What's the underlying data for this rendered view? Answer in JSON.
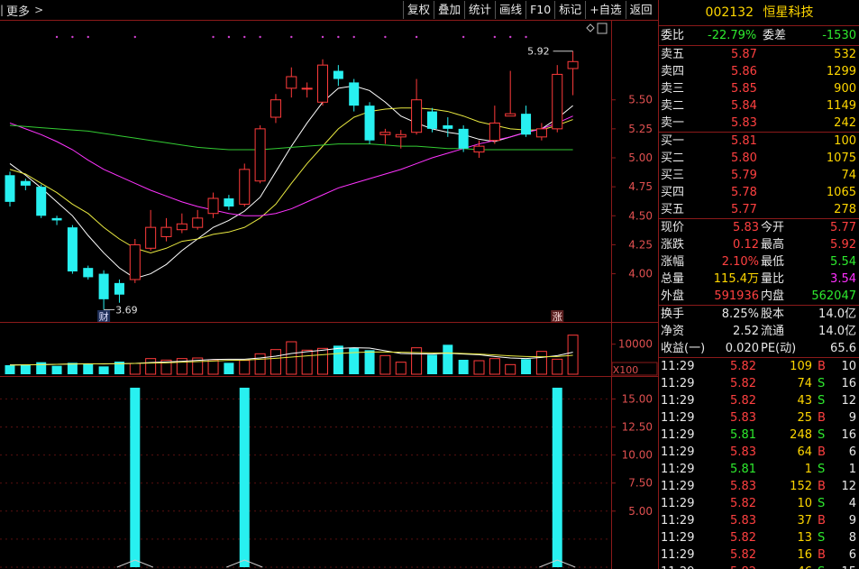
{
  "toolbar": {
    "left_label": "更多",
    "buttons": [
      "复权",
      "叠加",
      "统计",
      "画线",
      "F10",
      "标记",
      "+自选",
      "返回"
    ]
  },
  "stock": {
    "code": "002132",
    "name": "恒星科技"
  },
  "order_ratio": {
    "label1": "委比",
    "ratio": "-22.79%",
    "label2": "委差",
    "diff": "-1530"
  },
  "sell": [
    {
      "label": "卖五",
      "price": "5.87",
      "vol": "532"
    },
    {
      "label": "卖四",
      "price": "5.86",
      "vol": "1299"
    },
    {
      "label": "卖三",
      "price": "5.85",
      "vol": "900"
    },
    {
      "label": "卖二",
      "price": "5.84",
      "vol": "1149"
    },
    {
      "label": "卖一",
      "price": "5.83",
      "vol": "242"
    }
  ],
  "buy": [
    {
      "label": "买一",
      "price": "5.81",
      "vol": "100"
    },
    {
      "label": "买二",
      "price": "5.80",
      "vol": "1075"
    },
    {
      "label": "买三",
      "price": "5.79",
      "vol": "74"
    },
    {
      "label": "买四",
      "price": "5.78",
      "vol": "1065"
    },
    {
      "label": "买五",
      "price": "5.77",
      "vol": "278"
    }
  ],
  "quote": [
    {
      "l1": "现价",
      "v1": "5.83",
      "c1": "red",
      "l2": "今开",
      "v2": "5.77",
      "c2": "red"
    },
    {
      "l1": "涨跌",
      "v1": "0.12",
      "c1": "red",
      "l2": "最高",
      "v2": "5.92",
      "c2": "red"
    },
    {
      "l1": "涨幅",
      "v1": "2.10%",
      "c1": "red",
      "l2": "最低",
      "v2": "5.54",
      "c2": "green"
    },
    {
      "l1": "总量",
      "v1": "115.4万",
      "c1": "yellow",
      "l2": "量比",
      "v2": "3.54",
      "c2": "mag"
    },
    {
      "l1": "外盘",
      "v1": "591936",
      "c1": "red",
      "l2": "内盘",
      "v2": "562047",
      "c2": "green"
    }
  ],
  "fundamentals": [
    {
      "l1": "换手",
      "v1": "8.25%",
      "l2": "股本",
      "v2": "14.0亿"
    },
    {
      "l1": "净资",
      "v1": "2.52",
      "l2": "流通",
      "v2": "14.0亿"
    },
    {
      "l1": "收益(一)",
      "v1": "0.020",
      "l2": "PE(动)",
      "v2": "65.6"
    }
  ],
  "ticks": [
    {
      "t": "11:29",
      "p": "5.82",
      "v": "109",
      "d": "B",
      "n": "10"
    },
    {
      "t": "11:29",
      "p": "5.82",
      "v": "74",
      "d": "S",
      "n": "16"
    },
    {
      "t": "11:29",
      "p": "5.82",
      "v": "43",
      "d": "S",
      "n": "12"
    },
    {
      "t": "11:29",
      "p": "5.83",
      "v": "25",
      "d": "B",
      "n": "9"
    },
    {
      "t": "11:29",
      "p": "5.81",
      "v": "248",
      "d": "S",
      "n": "16"
    },
    {
      "t": "11:29",
      "p": "5.83",
      "v": "64",
      "d": "B",
      "n": "6"
    },
    {
      "t": "11:29",
      "p": "5.81",
      "v": "1",
      "d": "S",
      "n": "1"
    },
    {
      "t": "11:29",
      "p": "5.83",
      "v": "152",
      "d": "B",
      "n": "12"
    },
    {
      "t": "11:29",
      "p": "5.82",
      "v": "10",
      "d": "S",
      "n": "4"
    },
    {
      "t": "11:29",
      "p": "5.83",
      "v": "37",
      "d": "B",
      "n": "9"
    },
    {
      "t": "11:29",
      "p": "5.82",
      "v": "13",
      "d": "S",
      "n": "8"
    },
    {
      "t": "11:29",
      "p": "5.82",
      "v": "16",
      "d": "B",
      "n": "6"
    },
    {
      "t": "11:29",
      "p": "5.82",
      "v": "46",
      "d": "S",
      "n": "15"
    }
  ],
  "chart_data": [
    {
      "type": "candlestick",
      "ylim": [
        3.6,
        6.05
      ],
      "yticks": [
        "5.50",
        "5.25",
        "5.00",
        "4.75",
        "4.50",
        "4.25",
        "4.00"
      ],
      "annotations": {
        "high_label": "5.92",
        "low_label": "3.69",
        "marker_cai": "财",
        "marker_zhang": "涨"
      },
      "candles": [
        {
          "o": 4.85,
          "c": 4.62,
          "h": 4.88,
          "l": 4.58
        },
        {
          "o": 4.8,
          "c": 4.76,
          "h": 4.82,
          "l": 4.72
        },
        {
          "o": 4.75,
          "c": 4.5,
          "h": 4.77,
          "l": 4.48
        },
        {
          "o": 4.48,
          "c": 4.46,
          "h": 4.5,
          "l": 4.42
        },
        {
          "o": 4.4,
          "c": 4.02,
          "h": 4.42,
          "l": 4.0
        },
        {
          "o": 4.05,
          "c": 3.97,
          "h": 4.07,
          "l": 3.95
        },
        {
          "o": 4.0,
          "c": 3.78,
          "h": 4.03,
          "l": 3.69
        },
        {
          "o": 3.92,
          "c": 3.82,
          "h": 3.95,
          "l": 3.75
        },
        {
          "o": 3.95,
          "c": 4.25,
          "h": 4.3,
          "l": 3.92
        },
        {
          "o": 4.22,
          "c": 4.4,
          "h": 4.55,
          "l": 4.2
        },
        {
          "o": 4.32,
          "c": 4.4,
          "h": 4.48,
          "l": 4.28
        },
        {
          "o": 4.38,
          "c": 4.43,
          "h": 4.52,
          "l": 4.35
        },
        {
          "o": 4.4,
          "c": 4.48,
          "h": 4.55,
          "l": 4.38
        },
        {
          "o": 4.52,
          "c": 4.65,
          "h": 4.7,
          "l": 4.48
        },
        {
          "o": 4.65,
          "c": 4.58,
          "h": 4.68,
          "l": 4.55
        },
        {
          "o": 4.6,
          "c": 4.9,
          "h": 4.95,
          "l": 4.58
        },
        {
          "o": 4.8,
          "c": 5.25,
          "h": 5.28,
          "l": 4.78
        },
        {
          "o": 5.35,
          "c": 5.5,
          "h": 5.55,
          "l": 5.3
        },
        {
          "o": 5.6,
          "c": 5.7,
          "h": 5.78,
          "l": 5.52
        },
        {
          "o": 5.6,
          "c": 5.6,
          "h": 5.65,
          "l": 5.52
        },
        {
          "o": 5.48,
          "c": 5.8,
          "h": 5.85,
          "l": 5.45
        },
        {
          "o": 5.75,
          "c": 5.68,
          "h": 5.8,
          "l": 5.62
        },
        {
          "o": 5.65,
          "c": 5.45,
          "h": 5.68,
          "l": 5.4
        },
        {
          "o": 5.45,
          "c": 5.15,
          "h": 5.48,
          "l": 5.12
        },
        {
          "o": 5.2,
          "c": 5.22,
          "h": 5.25,
          "l": 5.12
        },
        {
          "o": 5.18,
          "c": 5.2,
          "h": 5.24,
          "l": 5.08
        },
        {
          "o": 5.22,
          "c": 5.5,
          "h": 5.68,
          "l": 5.2
        },
        {
          "o": 5.4,
          "c": 5.25,
          "h": 5.43,
          "l": 5.22
        },
        {
          "o": 5.28,
          "c": 5.25,
          "h": 5.35,
          "l": 5.18
        },
        {
          "o": 5.25,
          "c": 5.08,
          "h": 5.28,
          "l": 5.05
        },
        {
          "o": 5.05,
          "c": 5.1,
          "h": 5.15,
          "l": 5.0
        },
        {
          "o": 5.15,
          "c": 5.3,
          "h": 5.45,
          "l": 5.12
        },
        {
          "o": 5.36,
          "c": 5.38,
          "h": 5.75,
          "l": 5.36
        },
        {
          "o": 5.38,
          "c": 5.2,
          "h": 5.45,
          "l": 5.18
        },
        {
          "o": 5.18,
          "c": 5.25,
          "h": 5.3,
          "l": 5.15
        },
        {
          "o": 5.25,
          "c": 5.72,
          "h": 5.8,
          "l": 5.22
        },
        {
          "o": 5.77,
          "c": 5.83,
          "h": 5.92,
          "l": 5.54
        }
      ],
      "ma": [
        {
          "color": "#ffffff",
          "values": [
            4.95,
            4.85,
            4.74,
            4.62,
            4.5,
            4.33,
            4.18,
            4.05,
            3.96,
            4.0,
            4.08,
            4.2,
            4.3,
            4.4,
            4.46,
            4.54,
            4.66,
            4.88,
            5.1,
            5.3,
            5.48,
            5.6,
            5.62,
            5.58,
            5.48,
            5.36,
            5.3,
            5.25,
            5.22,
            5.2,
            5.16,
            5.14,
            5.18,
            5.22,
            5.25,
            5.34,
            5.45
          ]
        },
        {
          "color": "#e8e840",
          "values": [
            4.9,
            4.86,
            4.78,
            4.7,
            4.6,
            4.52,
            4.4,
            4.3,
            4.22,
            4.18,
            4.22,
            4.28,
            4.3,
            4.34,
            4.36,
            4.4,
            4.48,
            4.6,
            4.78,
            4.95,
            5.1,
            5.25,
            5.35,
            5.4,
            5.42,
            5.43,
            5.43,
            5.42,
            5.4,
            5.36,
            5.31,
            5.28,
            5.25,
            5.24,
            5.24,
            5.28,
            5.33
          ]
        },
        {
          "color": "#ff33ff",
          "values": [
            5.3,
            5.25,
            5.2,
            5.14,
            5.07,
            4.98,
            4.9,
            4.84,
            4.78,
            4.72,
            4.67,
            4.62,
            4.58,
            4.55,
            4.52,
            4.5,
            4.5,
            4.52,
            4.56,
            4.62,
            4.68,
            4.74,
            4.78,
            4.82,
            4.86,
            4.9,
            4.95,
            5.0,
            5.04,
            5.08,
            5.12,
            5.15,
            5.18,
            5.22,
            5.25,
            5.3,
            5.36
          ]
        },
        {
          "color": "#33cc33",
          "values": [
            5.28,
            5.27,
            5.26,
            5.25,
            5.24,
            5.23,
            5.21,
            5.19,
            5.17,
            5.15,
            5.13,
            5.11,
            5.09,
            5.08,
            5.07,
            5.07,
            5.07,
            5.08,
            5.09,
            5.1,
            5.11,
            5.12,
            5.12,
            5.12,
            5.11,
            5.1,
            5.1,
            5.09,
            5.08,
            5.08,
            5.07,
            5.07,
            5.07,
            5.07,
            5.07,
            5.07,
            5.07
          ]
        }
      ]
    },
    {
      "type": "bar",
      "scale_label": "X100",
      "ytick": "10000",
      "ylim": [
        0,
        15000
      ],
      "values": [
        3000,
        3200,
        4000,
        2800,
        3800,
        3600,
        2600,
        4200,
        3600,
        5200,
        4700,
        5200,
        5400,
        4800,
        3800,
        4600,
        6800,
        8200,
        10800,
        8000,
        8600,
        9500,
        8800,
        8000,
        6200,
        4000,
        8800,
        6500,
        9800,
        4800,
        4500,
        5200,
        3200,
        5000,
        7600,
        5000,
        13000,
        11000
      ]
    },
    {
      "type": "bar",
      "ylim": [
        0,
        16.8
      ],
      "yticks": [
        "15.00",
        "12.50",
        "10.00",
        "7.50",
        "5.00"
      ],
      "values": [
        0,
        0,
        0,
        0,
        0,
        0,
        0,
        0,
        16,
        0,
        0,
        0,
        0,
        0,
        0,
        16,
        0,
        0,
        0,
        0,
        0,
        0,
        0,
        0,
        0,
        0,
        0,
        0,
        0,
        0,
        0,
        0,
        0,
        0,
        0,
        16,
        0
      ]
    }
  ]
}
